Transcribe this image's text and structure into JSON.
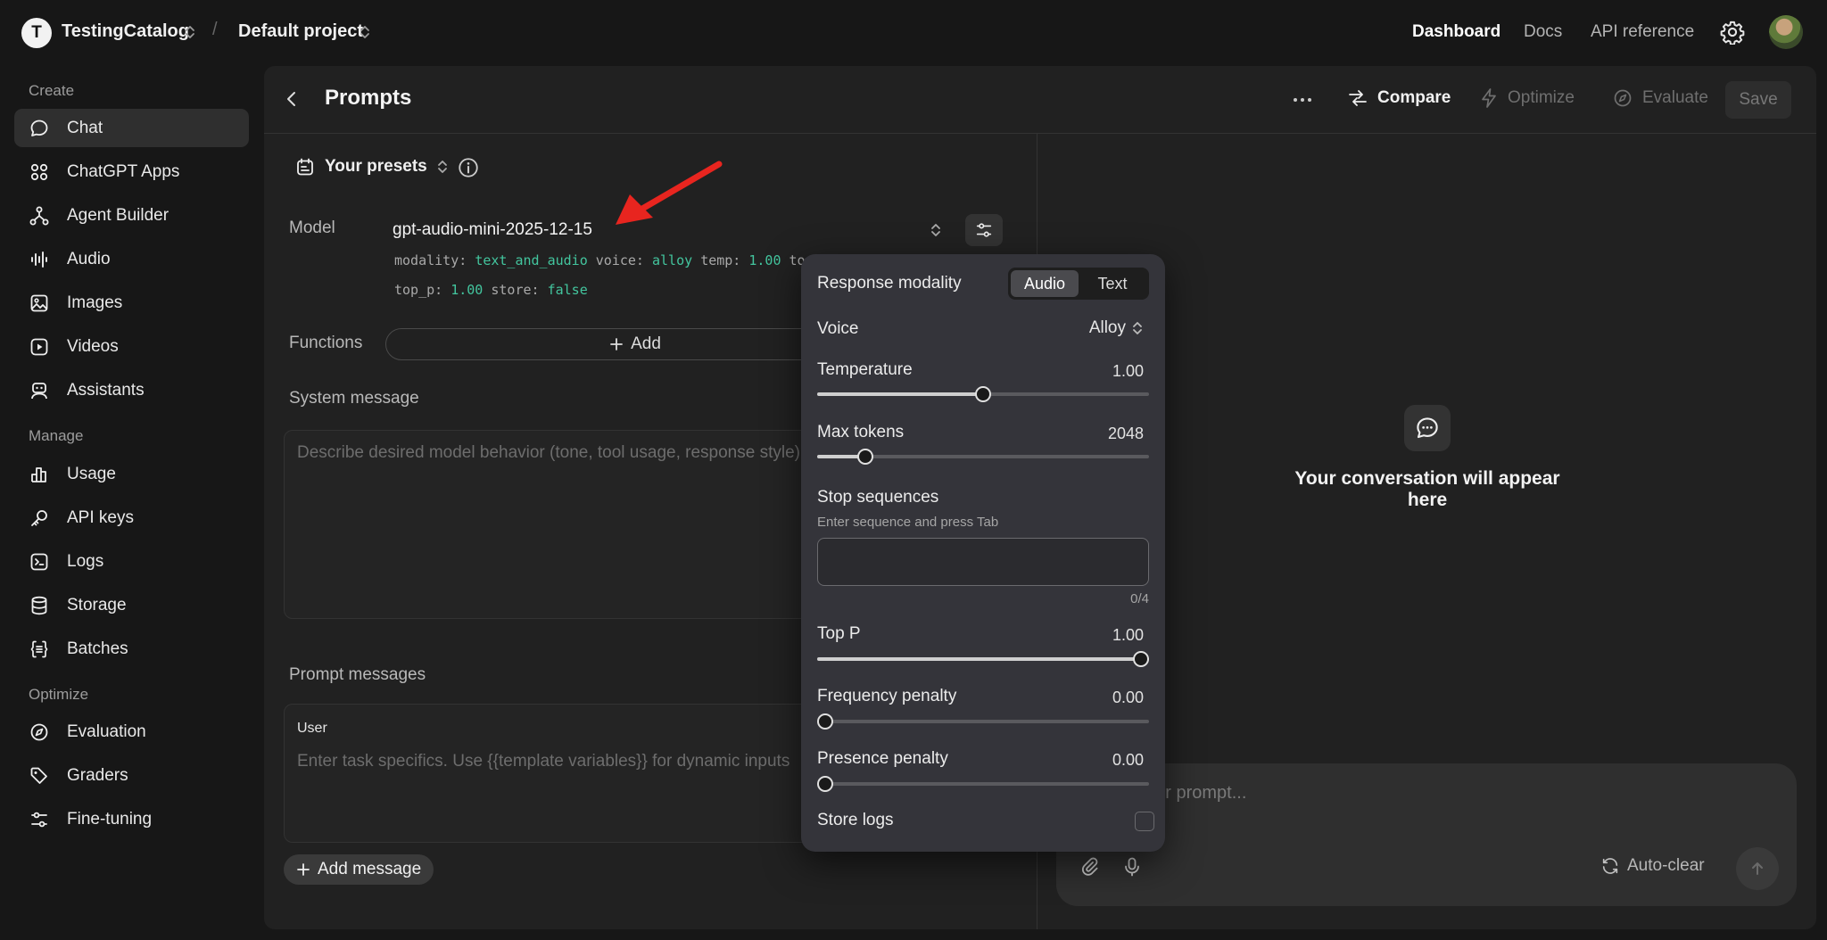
{
  "topbar": {
    "org_initial": "T",
    "org_name": "TestingCatalog",
    "separator": "/",
    "project_name": "Default project",
    "links": [
      "Dashboard",
      "Docs",
      "API reference"
    ],
    "active_link": "Dashboard"
  },
  "sidebar": {
    "create_label": "Create",
    "manage_label": "Manage",
    "optimize_label": "Optimize",
    "create_items": [
      {
        "label": "Chat",
        "icon": "chat-bubble-icon"
      },
      {
        "label": "ChatGPT Apps",
        "icon": "apps-grid-icon"
      },
      {
        "label": "Agent Builder",
        "icon": "agent-nodes-icon"
      },
      {
        "label": "Audio",
        "icon": "audio-wave-icon"
      },
      {
        "label": "Images",
        "icon": "image-icon"
      },
      {
        "label": "Videos",
        "icon": "play-icon"
      },
      {
        "label": "Assistants",
        "icon": "robot-icon"
      }
    ],
    "manage_items": [
      {
        "label": "Usage",
        "icon": "bar-chart-icon"
      },
      {
        "label": "API keys",
        "icon": "key-icon"
      },
      {
        "label": "Logs",
        "icon": "terminal-icon"
      },
      {
        "label": "Storage",
        "icon": "database-icon"
      },
      {
        "label": "Batches",
        "icon": "braces-icon"
      }
    ],
    "optimize_items": [
      {
        "label": "Evaluation",
        "icon": "compass-icon"
      },
      {
        "label": "Graders",
        "icon": "tag-icon"
      },
      {
        "label": "Fine-tuning",
        "icon": "sliders-icon"
      }
    ],
    "active": "Chat"
  },
  "panel": {
    "title": "Prompts",
    "compare_label": "Compare",
    "optimize_label": "Optimize",
    "evaluate_label": "Evaluate",
    "save_label": "Save"
  },
  "left": {
    "presets_label": "Your presets",
    "model_label": "Model",
    "model_name": "gpt-audio-mini-2025-12-15",
    "params_line1": {
      "modality_key": "modality:",
      "modality_val": "text_and_audio",
      "voice_key": "voice:",
      "voice_val": "alloy",
      "temp_key": "temp:",
      "temp_val": "1.00",
      "trunc": "to"
    },
    "params_line2": {
      "top_p_key": "top_p:",
      "top_p_val": "1.00",
      "store_key": "store:",
      "store_val": "false"
    },
    "functions_label": "Functions",
    "functions_add": "Add",
    "system_label": "System message",
    "system_placeholder": "Describe desired model behavior (tone, tool usage, response style)",
    "prompt_messages_label": "Prompt messages",
    "message_role": "User",
    "message_placeholder": "Enter task specifics. Use {{template variables}} for dynamic inputs",
    "add_message_label": "Add message"
  },
  "right": {
    "empty_text": "Your conversation will appear here",
    "composer_placeholder": "your prompt...",
    "autoclear_label": "Auto-clear"
  },
  "popover": {
    "modality_label": "Response modality",
    "modality_options": [
      "Audio",
      "Text"
    ],
    "modality_selected": "Audio",
    "voice_label": "Voice",
    "voice_value": "Alloy",
    "temperature_label": "Temperature",
    "temperature_value": "1.00",
    "temperature_fraction": 0.5,
    "max_tokens_label": "Max tokens",
    "max_tokens_value": "2048",
    "max_tokens_fraction": 0.145,
    "stop_label": "Stop sequences",
    "stop_hint": "Enter sequence and press Tab",
    "stop_count": "0/4",
    "top_p_label": "Top P",
    "top_p_value": "1.00",
    "top_p_fraction": 1.0,
    "freq_label": "Frequency penalty",
    "freq_value": "0.00",
    "freq_fraction": 0.0,
    "presence_label": "Presence penalty",
    "presence_value": "0.00",
    "presence_fraction": 0.0,
    "store_logs_label": "Store logs",
    "store_logs_checked": false
  },
  "colors": {
    "accent_green": "#43c59e",
    "annotation_red": "#e8251f"
  }
}
